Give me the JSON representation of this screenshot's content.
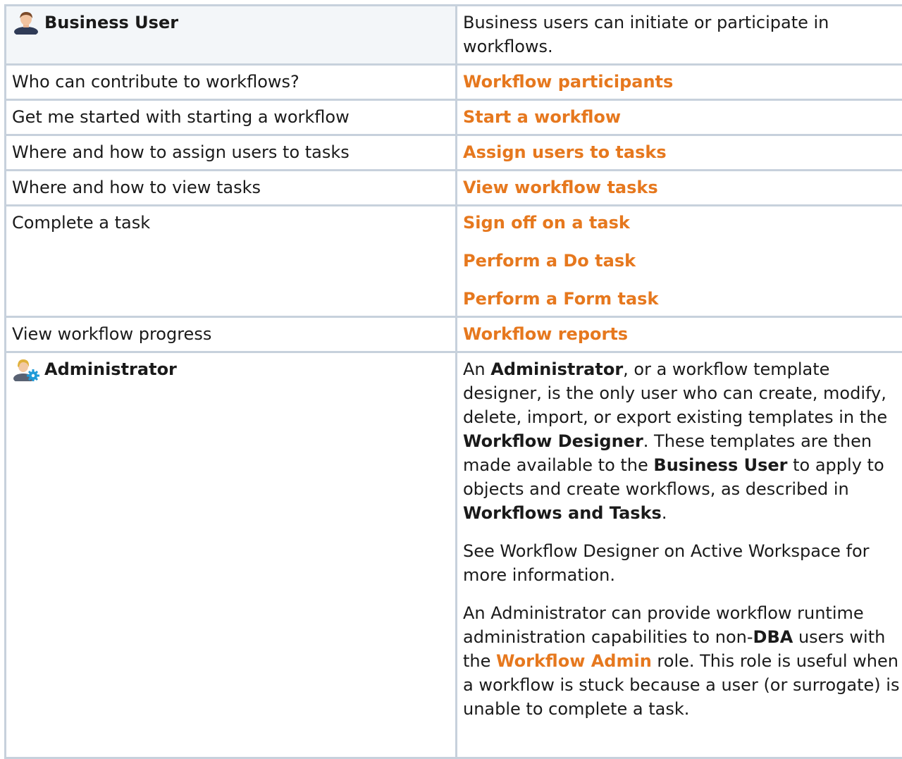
{
  "business_user": {
    "role_label": "Business User",
    "description": "Business users can initiate or participate in workflows."
  },
  "rows": [
    {
      "question": "Who can contribute to workflows?",
      "links": [
        "Workflow participants"
      ]
    },
    {
      "question": "Get me started with starting a workflow",
      "links": [
        "Start a workflow"
      ]
    },
    {
      "question": "Where and how to assign users to tasks",
      "links": [
        "Assign users to tasks"
      ]
    },
    {
      "question": "Where and how to view tasks",
      "links": [
        "View workflow tasks"
      ]
    },
    {
      "question": "Complete a task",
      "links": [
        "Sign off on a task",
        "Perform a Do task",
        "Perform a Form task"
      ]
    },
    {
      "question": "View workflow progress",
      "links": [
        "Workflow reports"
      ]
    }
  ],
  "administrator": {
    "role_label": "Administrator",
    "para1": {
      "t1": "An ",
      "b1": "Administrator",
      "t2": ", or a workflow template designer, is the only user who can create, modify, delete, import, or export existing templates in the ",
      "b2": "Workflow Designer",
      "t3": ". These templates are then made available to the ",
      "b3": "Business User",
      "t4": " to apply to objects and create workflows, as described in ",
      "b4": "Workflows and Tasks",
      "t5": "."
    },
    "para2": "See Workflow Designer on Active Workspace for more information.",
    "para3": {
      "t1": "An Administrator can provide workflow runtime administration capabilities to non-",
      "b1": "DBA",
      "t2": " users with the ",
      "link": "Workflow Admin",
      "t3": " role. This role is useful when a workflow is stuck because a user (or surrogate) is unable to complete a task."
    }
  },
  "colors": {
    "link": "#e6781e",
    "border": "#c7d1dc",
    "header_bg": "#f3f6f9"
  },
  "icons": {
    "business_user": "business-user-icon",
    "administrator": "administrator-icon"
  }
}
